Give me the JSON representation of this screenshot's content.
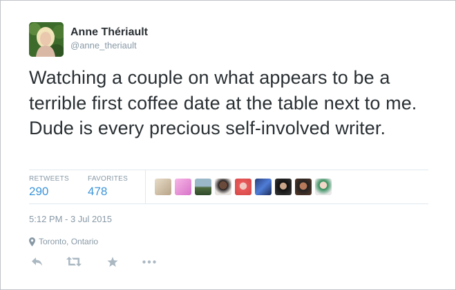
{
  "author": {
    "name": "Anne Thériault",
    "handle": "@anne_theriault",
    "avatar_icon": "profile-photo"
  },
  "tweet": {
    "text": "Watching a couple on what appears to be a terrible first coffee date at the table next to me. Dude is every precious self-involved writer."
  },
  "stats": {
    "retweets_label": "RETWEETS",
    "retweets_count": "290",
    "favorites_label": "FAVORITES",
    "favorites_count": "478"
  },
  "favoriters_count_shown": 9,
  "timestamp": "5:12 PM - 3 Jul 2015",
  "location": {
    "icon": "map-pin-icon",
    "text": "Toronto, Ontario"
  },
  "actions": [
    "reply-icon",
    "retweet-icon",
    "favorite-icon",
    "more-icon"
  ],
  "colors": {
    "link_blue": "#3b94d9",
    "text_dark": "#292f33",
    "text_muted": "#8899a6",
    "border": "#e1e8ed",
    "action_icon": "#aab8c2"
  }
}
